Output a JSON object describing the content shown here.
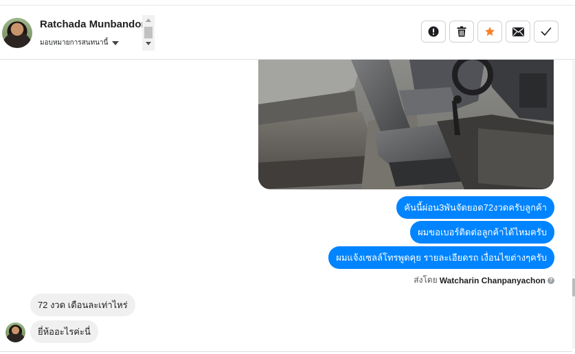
{
  "conversation": {
    "contact_name": "Ratchada Munbandong",
    "assign_label": "มอบหมายการสนทนานี้"
  },
  "toolbar": {
    "buttons": [
      {
        "name": "report-spam-button",
        "icon": "alert-circle-icon"
      },
      {
        "name": "delete-button",
        "icon": "trash-icon"
      },
      {
        "name": "star-button",
        "icon": "star-icon",
        "color": "#f5822a"
      },
      {
        "name": "mark-unread-button",
        "icon": "envelope-icon"
      },
      {
        "name": "mark-done-button",
        "icon": "check-icon"
      }
    ]
  },
  "messages": {
    "outgoing": [
      "คันนี้ผ่อน3พันจัดยอด72งวดครับลูกค้า",
      "ผมขอเบอร์ติดต่อลูกค้าได้ไหมครับ",
      "ผมแจ้งเซลล์โทรพูดคุย รายละเอียดรถ เงื่อนไขต่างๆครับ"
    ],
    "sent_by_label": "ส่งโดย",
    "sent_by_name": "Watcharin Chanpanyachon",
    "incoming": [
      "72 งวด เดือนละเท่าไหร่",
      "ยี่ห้ออะไรค่ะนี่"
    ]
  },
  "colors": {
    "outgoing_bubble": "#0084ff",
    "incoming_bubble": "#f0f0f0",
    "star_accent": "#f5822a"
  }
}
